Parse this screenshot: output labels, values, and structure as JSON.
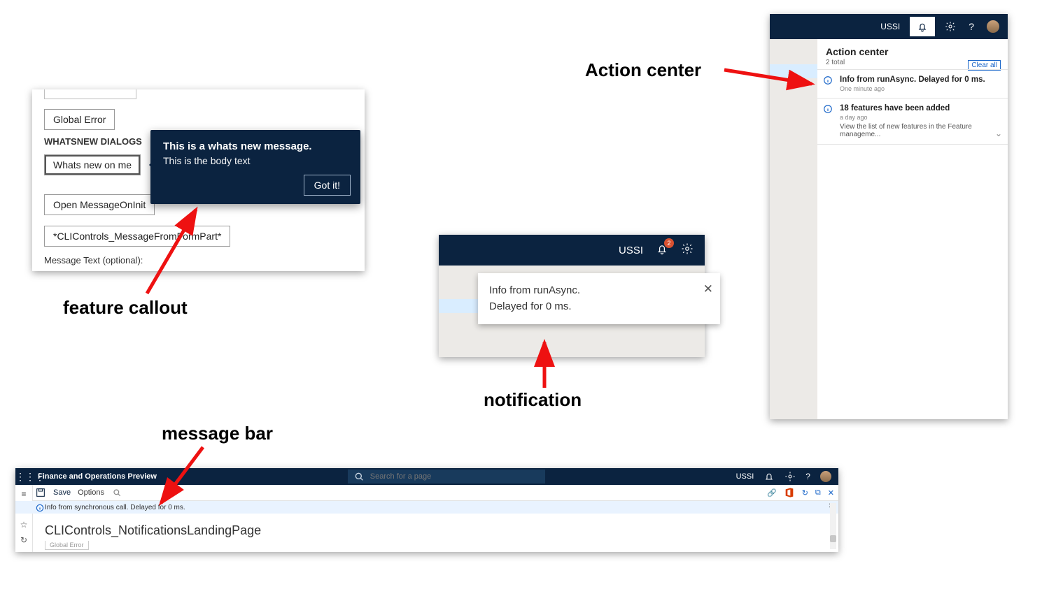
{
  "annotations": {
    "feature_callout": "feature callout",
    "notification": "notification",
    "action_center": "Action center",
    "message_bar": "message bar"
  },
  "callout": {
    "btn_global_error": "Global Error",
    "section_label": "WHATSNEW DIALOGS",
    "btn_whats_new": "Whats new on me",
    "btn_whats_new_partial": "ts new",
    "btn_open_msg": "Open MessageOnInit",
    "btn_cli": "*CLIControls_MessageFromFormPart*",
    "lbl_msgtext": "Message Text (optional):",
    "flyout_title": "This is a whats new message.",
    "flyout_body": "This is the body text",
    "flyout_btn": "Got it!"
  },
  "notification": {
    "company": "USSI",
    "badge": "2",
    "toast_line1": "Info from runAsync.",
    "toast_line2": "Delayed for 0 ms."
  },
  "action_center": {
    "company": "USSI",
    "title": "Action center",
    "total": "2 total",
    "clear": "Clear all",
    "item1_title": "Info from runAsync. Delayed for 0 ms.",
    "item1_meta": "One minute ago",
    "item2_title": "18 features have been added",
    "item2_meta": "a day ago",
    "item2_desc": "View the list of new features in the Feature manageme..."
  },
  "message_bar": {
    "app_title": "Finance and Operations Preview",
    "company": "USSI",
    "search_placeholder": "Search for a page",
    "save": "Save",
    "options": "Options",
    "msg_text": "Info from synchronous call. Delayed for 0 ms.",
    "page_title": "CLIControls_NotificationsLandingPage",
    "ghost": "Global Error"
  }
}
